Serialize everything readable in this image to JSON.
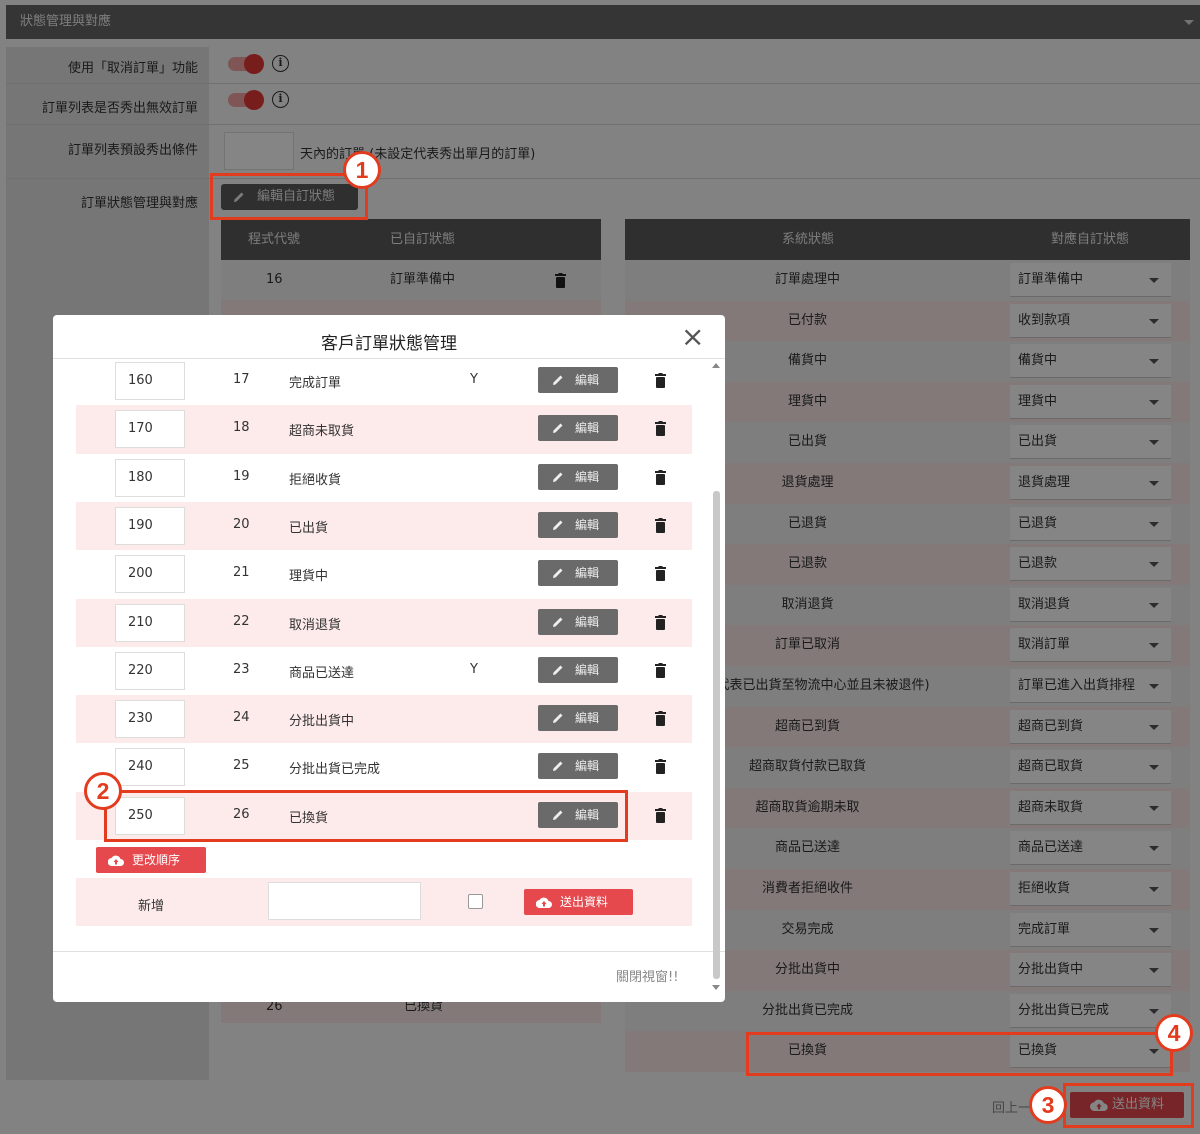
{
  "panel": {
    "title": "狀態管理與對應"
  },
  "form": {
    "cancel_label": "使用「取消訂單」功能",
    "invalid_label": "訂單列表是否秀出無效訂單",
    "preset_label": "訂單列表預設秀出條件",
    "preset_suffix": "天內的訂單 (未設定代表秀出單月的訂單)",
    "mapping_label": "訂單狀態管理與對應",
    "edit_custom_label": "編輯自訂狀態"
  },
  "left_table": {
    "headers": [
      "程式代號",
      "已自訂狀態"
    ],
    "rows": [
      {
        "code": "16",
        "name": "訂單準備中"
      },
      {
        "code": "26",
        "name": "已換貨"
      }
    ]
  },
  "right_table": {
    "headers": [
      "系統狀態",
      "對應自訂狀態"
    ],
    "rows": [
      {
        "sys": "訂單處理中",
        "mapped": "訂單準備中"
      },
      {
        "sys": "已付款",
        "mapped": "收到款項"
      },
      {
        "sys": "備貨中",
        "mapped": "備貨中"
      },
      {
        "sys": "理貨中",
        "mapped": "理貨中"
      },
      {
        "sys": "已出貨",
        "mapped": "已出貨"
      },
      {
        "sys": "退貨處理",
        "mapped": "退貨處理"
      },
      {
        "sys": "已退貨",
        "mapped": "已退貨"
      },
      {
        "sys": "已退款",
        "mapped": "已退款"
      },
      {
        "sys": "取消退貨",
        "mapped": "取消退貨"
      },
      {
        "sys": "訂單已取消",
        "mapped": "取消訂單"
      },
      {
        "sys": "成功(代表已出貨至物流中心並且未被退件)",
        "mapped": "訂單已進入出貨排程"
      },
      {
        "sys": "超商已到貨",
        "mapped": "超商已到貨"
      },
      {
        "sys": "超商取貨付款已取貨",
        "mapped": "超商已取貨"
      },
      {
        "sys": "超商取貨逾期未取",
        "mapped": "超商未取貨"
      },
      {
        "sys": "商品已送達",
        "mapped": "商品已送達"
      },
      {
        "sys": "消費者拒絕收件",
        "mapped": "拒絕收貨"
      },
      {
        "sys": "交易完成",
        "mapped": "完成訂單"
      },
      {
        "sys": "分批出貨中",
        "mapped": "分批出貨中"
      },
      {
        "sys": "分批出貨已完成",
        "mapped": "分批出貨已完成"
      },
      {
        "sys": "已換貨",
        "mapped": "已換貨"
      }
    ]
  },
  "modal": {
    "title": "客戶訂單狀態管理",
    "edit_label": "編輯",
    "rows": [
      {
        "order": "160",
        "code": "17",
        "name": "完成訂單",
        "flag": "Y"
      },
      {
        "order": "170",
        "code": "18",
        "name": "超商未取貨",
        "flag": ""
      },
      {
        "order": "180",
        "code": "19",
        "name": "拒絕收貨",
        "flag": ""
      },
      {
        "order": "190",
        "code": "20",
        "name": "已出貨",
        "flag": ""
      },
      {
        "order": "200",
        "code": "21",
        "name": "理貨中",
        "flag": ""
      },
      {
        "order": "210",
        "code": "22",
        "name": "取消退貨",
        "flag": ""
      },
      {
        "order": "220",
        "code": "23",
        "name": "商品已送達",
        "flag": "Y"
      },
      {
        "order": "230",
        "code": "24",
        "name": "分批出貨中",
        "flag": ""
      },
      {
        "order": "240",
        "code": "25",
        "name": "分批出貨已完成",
        "flag": ""
      },
      {
        "order": "250",
        "code": "26",
        "name": "已換貨",
        "flag": ""
      }
    ],
    "reorder_label": "更改順序",
    "new_label": "新增",
    "submit_label": "送出資料",
    "close_label": "關閉視窗!!"
  },
  "footer": {
    "back_label": "回上一",
    "submit_label": "送出資料"
  },
  "callouts": [
    "1",
    "2",
    "3",
    "4"
  ],
  "colors": {
    "accent": "#e5484d",
    "callout": "#e33b1e",
    "header": "#5a5a5a",
    "pink_row": "#fdeaea"
  }
}
